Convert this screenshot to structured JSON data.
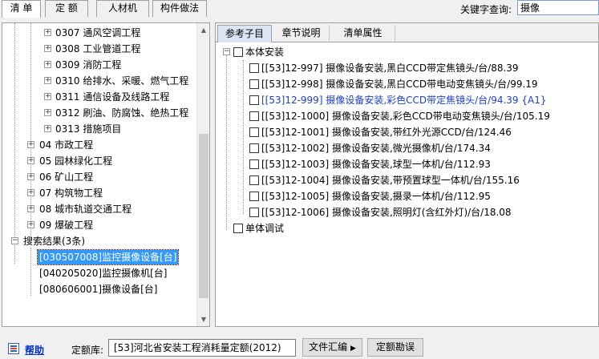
{
  "top_tabs": [
    "清 单",
    "定 额",
    "人材机",
    "构件做法"
  ],
  "search": {
    "label": "关键字查询:",
    "value": "摄像"
  },
  "tree": {
    "items": [
      "0307 通风空调工程",
      "0308 工业管道工程",
      "0309 消防工程",
      "0310 给排水、采暖、燃气工程",
      "0311 通信设备及线路工程",
      "0312 刷油、防腐蚀、绝热工程",
      "0313 措施项目",
      "04 市政工程",
      "05 园林绿化工程",
      "06 矿山工程",
      "07 构筑物工程",
      "08 城市轨道交通工程",
      "09 爆破工程",
      "搜索结果(3条)",
      "[030507008]监控摄像设备[台]",
      "[040205020]监控摄像机[台]",
      "[080606001]摄像设备[台]"
    ]
  },
  "right_tabs": [
    "参考子目",
    "章节说明",
    "清单属性"
  ],
  "groups": {
    "body_install": "本体安装",
    "unit_debug": "单体调试"
  },
  "items": [
    "[[53]12-997]  摄像设备安装,黑白CCD带定焦镜头/台/88.39",
    "[[53]12-998]  摄像设备安装,黑白CCD带电动变焦镜头/台/99.19",
    "[[53]12-999]  摄像设备安装,彩色CCD带定焦镜头/台/94.39 {A1}",
    "[[53]12-1000]  摄像设备安装,彩色CCD带电动变焦镜头/台/105.19",
    "[[53]12-1001]  摄像设备安装,带红外光源CCD/台/124.46",
    "[[53]12-1002]  摄像设备安装,微光摄像机/台/174.34",
    "[[53]12-1003]  摄像设备安装,球型一体机/台/112.93",
    "[[53]12-1004]  摄像设备安装,带预置球型一体机/台/155.16",
    "[[53]12-1005]  摄像设备安装,摄录一体机/台/112.95",
    "[[53]12-1006]  摄像设备安装,照明灯(含红外灯)/台/18.08"
  ],
  "bottom": {
    "help": "帮助",
    "lib_label": "定额库:",
    "lib_value": "[53]河北省安装工程消耗量定额(2012)",
    "file_btn": "文件汇编",
    "errata_btn": "定额勘误"
  },
  "colors": {
    "selection": "#3399ff",
    "highlight_text": "#1c3fd1",
    "link": "#0033cc"
  }
}
